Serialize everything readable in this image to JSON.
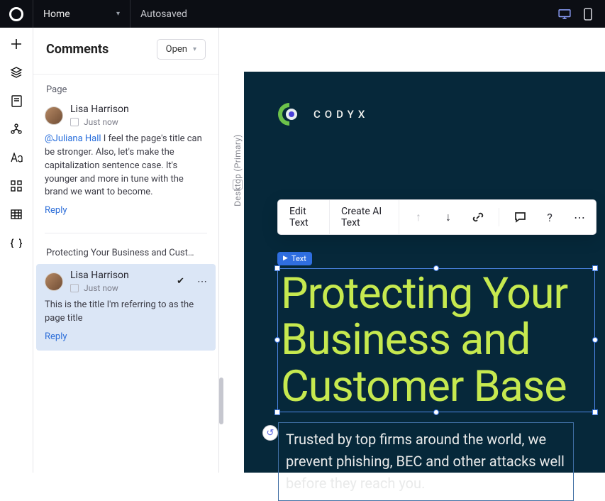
{
  "topbar": {
    "nav_label": "Home",
    "save_status": "Autosaved"
  },
  "sidebar": {
    "title": "Comments",
    "filter_label": "Open",
    "section_label": "Page",
    "thread_label": "Protecting Your Business and Cust…",
    "reply_label": "Reply",
    "comments": [
      {
        "author": "Lisa Harrison",
        "time": "Just now",
        "mention": "@Juliana Hall",
        "body": "I feel the page's title can be stronger. Also, let's make the capitalization sentence case. It's younger and more in tune with the brand we want to become."
      },
      {
        "author": "Lisa Harrison",
        "time": "Just now",
        "body": "This is the title I'm referring to as the page title"
      }
    ]
  },
  "canvas": {
    "breakpoint_label": "Desktop (Primary)",
    "brand_name": "CODYX",
    "title_text": "Protecting Your Business and Customer Base",
    "subtitle_text": "Trusted by top firms around the world, we prevent phishing, BEC and other attacks well before they reach you.",
    "selection_tag": "Text"
  },
  "toolbar": {
    "edit_text": "Edit Text",
    "create_ai_text": "Create AI Text"
  },
  "colors": {
    "hero_bg": "#06283a",
    "accent_lime": "#c6e94f",
    "select_blue": "#3c77df"
  }
}
